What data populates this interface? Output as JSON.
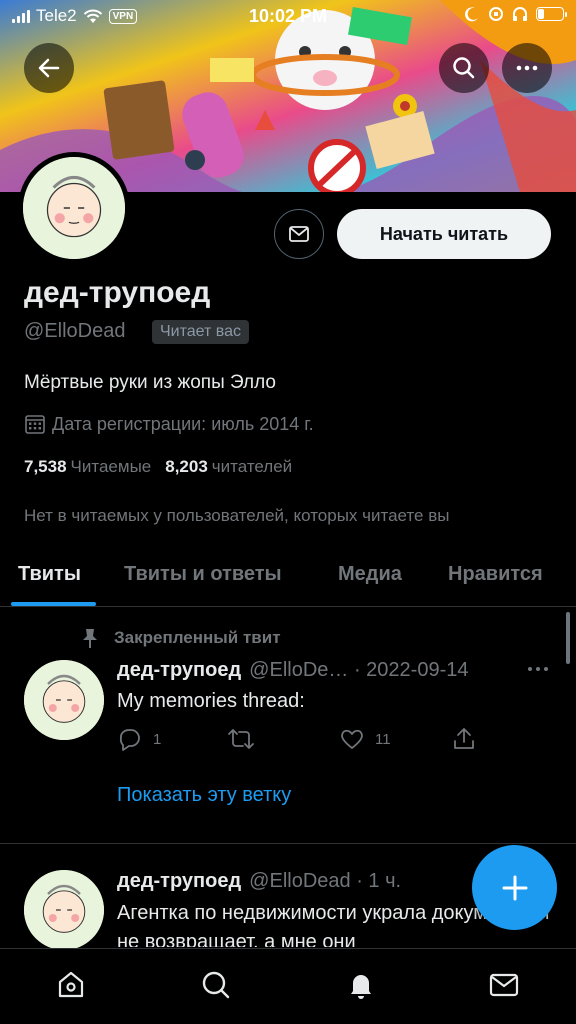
{
  "status_bar": {
    "carrier": "Tele2",
    "vpn": "VPN",
    "time": "10:02 PM",
    "battery_level": 0.25
  },
  "profile": {
    "display_name": "дед-трупоед",
    "handle": "@ElloDead",
    "follows_you": "Читает вас",
    "bio": "Мёртвые руки из жопы Элло",
    "joined": "Дата регистрации: июль 2014 г.",
    "following_count": "7,538",
    "following_label": "Читаемые",
    "followers_count": "8,203",
    "followers_label": "читателей",
    "mutuals_note": "Нет в читаемых у пользователей, которых читаете вы",
    "follow_button": "Начать читать"
  },
  "tabs": [
    {
      "label": "Твиты",
      "active": true
    },
    {
      "label": "Твиты и ответы",
      "active": false
    },
    {
      "label": "Медиа",
      "active": false
    },
    {
      "label": "Нравится",
      "active": false
    }
  ],
  "tweets": [
    {
      "pinned_label": "Закрепленный твит",
      "name": "дед-трупоед",
      "meta": "@ElloDe… · 2022-09-14",
      "text": "My memories thread:",
      "replies": "1",
      "retweets": "",
      "likes": "11",
      "show_thread": "Показать эту ветку"
    },
    {
      "name": "дед-трупоед",
      "meta": "@ElloDead · 1 ч.",
      "text": "Агентка по недвижимости украла документы и не возвращает, а мне они"
    }
  ],
  "colors": {
    "accent": "#1d9bf0",
    "background": "#000000",
    "secondary_text": "#71767b"
  }
}
